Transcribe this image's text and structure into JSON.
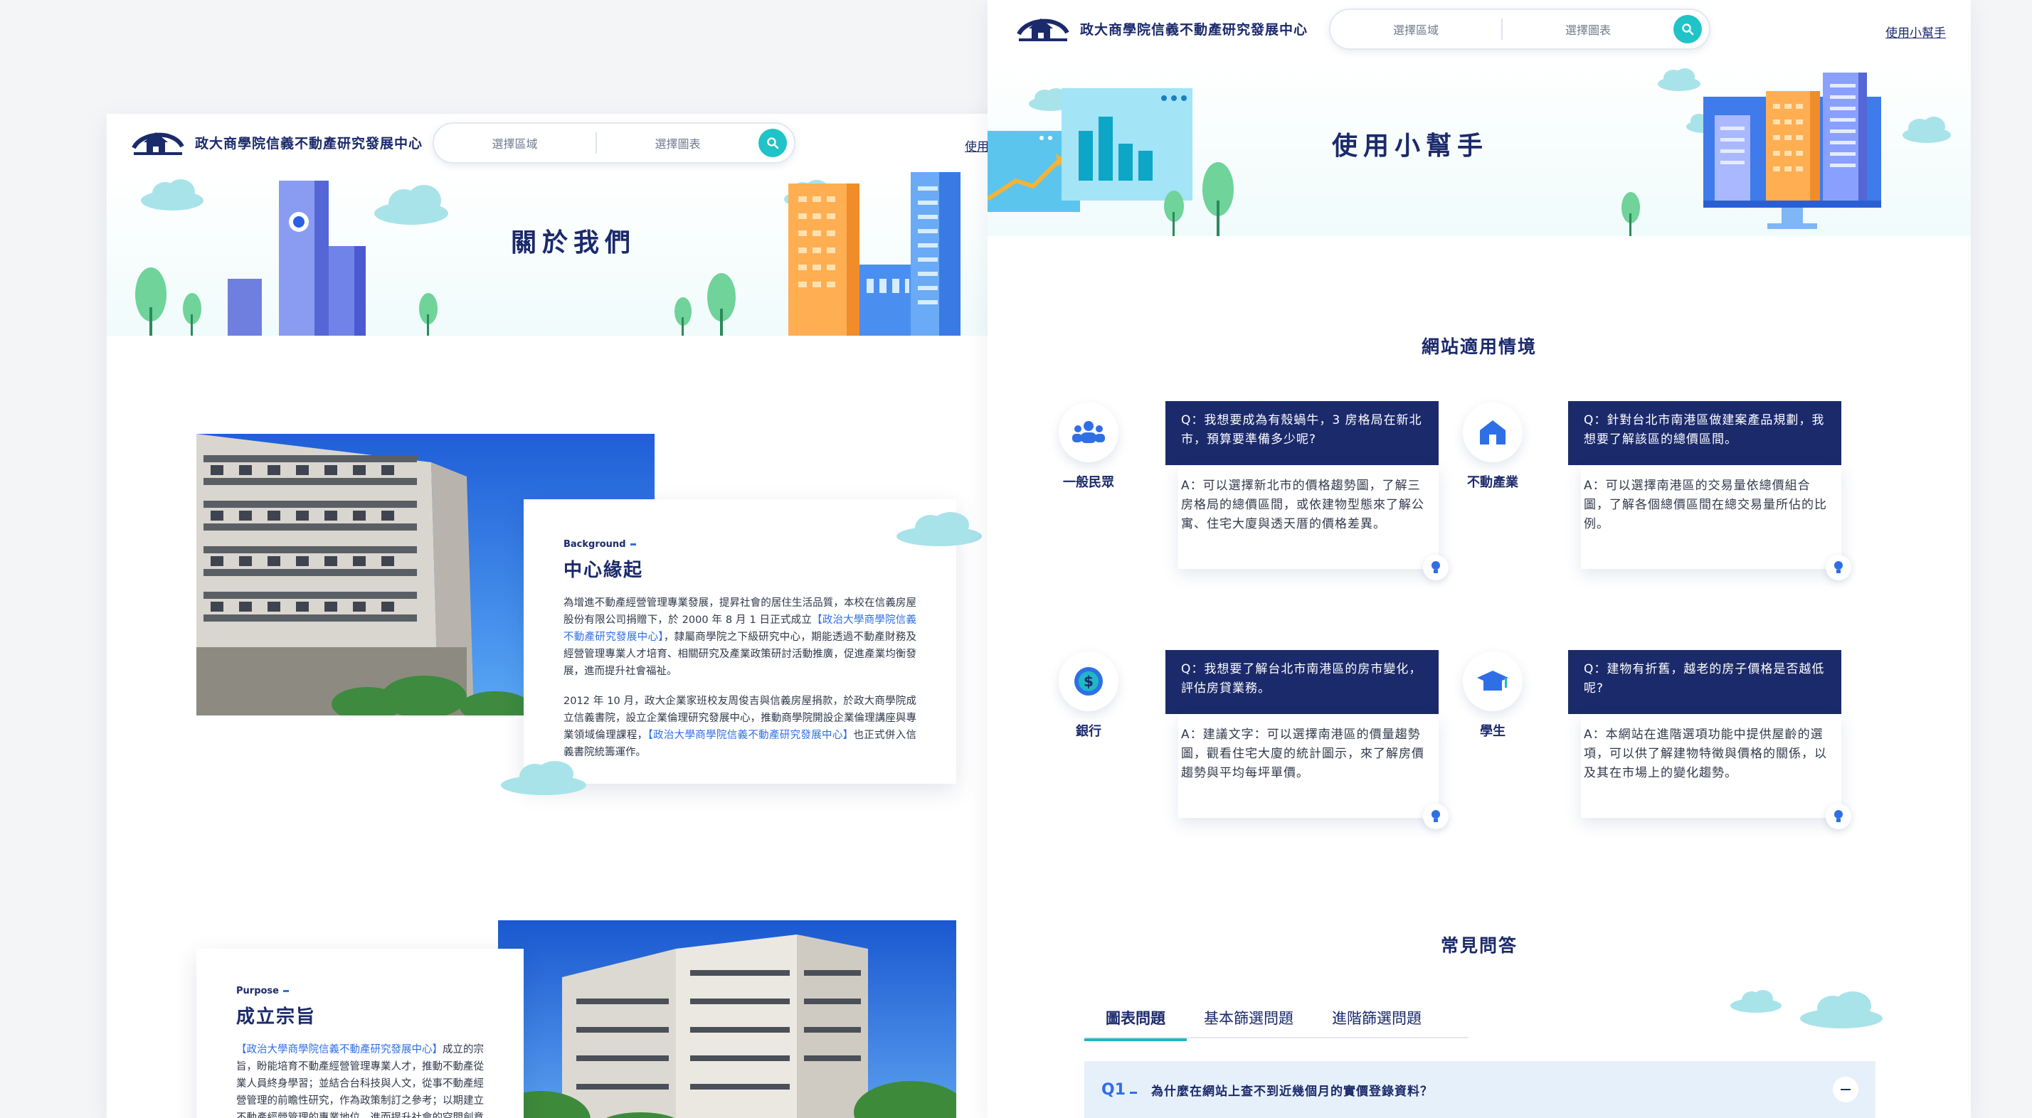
{
  "brand": {
    "center_name": "政大商學院信義不動產研究發展中心"
  },
  "search": {
    "region_placeholder": "選擇區域",
    "chart_placeholder": "選擇圖表"
  },
  "nav": {
    "help_link": "使用小幫手"
  },
  "about_page": {
    "hero_title": "關於我們",
    "background": {
      "kicker": "Background",
      "heading": "中心緣起",
      "p1_a": "為增進不動產經營管理專業發展，提昇社會的居住生活品質，本校在信義房屋股份有限公司捐贈下，於 2000 年 8 月 1 日正式成立",
      "p1_link": "【政治大學商學院信義不動產研究發展中心】",
      "p1_b": "，隸屬商學院之下級研究中心，期能透過不動產財務及經營管理專業人才培育、相關研究及產業政策研討活動推廣，促進產業均衡發展，進而提升社會福祉。",
      "p2_a": "2012 年 10 月，政大企業家班校友周俊吉與信義房屋捐款，於政大商學院成立信義書院，設立企業倫理研究發展中心，推動商學院開設企業倫理講座與專業領域倫理課程，",
      "p2_link": "【政治大學商學院信義不動產研究發展中心】",
      "p2_b": "也正式併入信義書院統籌運作。"
    },
    "purpose": {
      "kicker": "Purpose",
      "heading": "成立宗旨",
      "p1_link": "【政治大學商學院信義不動產研究發展中心】",
      "p1_b": "成立的宗旨，盼能培育不動產經營管理專業人才，推動不動產從業人員終身學習；並結合台科技與人文，從事不動產經營管理的前瞻性研究，作為政策制訂之參考；以期建立不動產經營管理的專業地位，進而提升社會的空間創意與居住生活品"
    }
  },
  "help_page": {
    "hero_title": "使用小幫手",
    "scenarios_title": "網站適用情境",
    "scenarios": [
      {
        "persona": "一般民眾",
        "question": "Q：我想要成為有殼蝸牛，3 房格局在新北市，預算要準備多少呢?",
        "answer": "A：可以選擇新北市的價格趨勢圖，了解三房格局的總價區間，或依建物型態來了解公寓、住宅大廈與透天厝的價格差異。"
      },
      {
        "persona": "不動產業",
        "question": "Q：針對台北市南港區做建案產品規劃，我想要了解該區的總價區間。",
        "answer": "A：可以選擇南港區的交易量依總價組合圖，了解各個總價區間在總交易量所佔的比例。"
      },
      {
        "persona": "銀行",
        "question": "Q：我想要了解台北市南港區的房市變化，評估房貸業務。",
        "answer": "A：建議文字：可以選擇南港區的價量趨勢圖，觀看住宅大廈的統計圖示，來了解房價趨勢與平均每坪單價。"
      },
      {
        "persona": "學生",
        "question": "Q：建物有折舊，越老的房子價格是否越低呢?",
        "answer": "A：本網站在進階選項功能中提供屋齡的選項，可以供了解建物特徵與價格的關係，以及其在市場上的變化趨勢。"
      }
    ],
    "faq_title": "常見問答",
    "faq_tabs": [
      "圖表問題",
      "基本篩選問題",
      "進階篩選問題"
    ],
    "faq_items": [
      {
        "num": "Q1",
        "question": "為什麼在網站上查不到近幾個月的實價登錄資料？"
      }
    ]
  },
  "colors": {
    "navy": "#1b2a6b",
    "teal": "#20c3c7",
    "link_blue": "#2f6fe6",
    "faq_bg": "#e6f0fb"
  },
  "icons": [
    "search-icon",
    "people-icon",
    "house-icon",
    "coin-icon",
    "graduation-cap-icon",
    "lightbulb-icon",
    "collapse-icon"
  ]
}
